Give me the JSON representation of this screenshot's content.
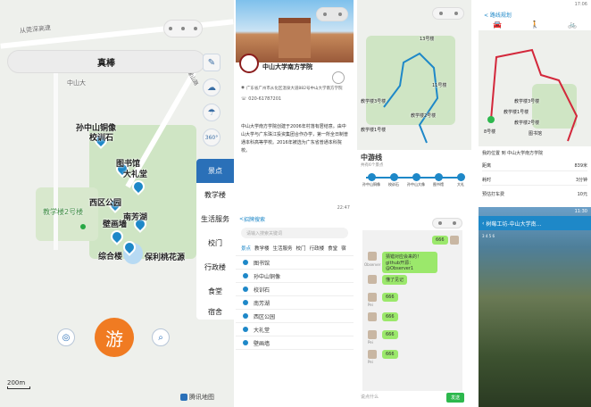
{
  "p1": {
    "search_text": "真棒",
    "map_labels": [
      "孙中山铜像",
      "校训石",
      "图书馆",
      "大礼堂",
      "西区公园",
      "南芳湖",
      "壁画墙",
      "综合楼",
      "保利桃花源",
      "教学楼2号楼",
      "中山大",
      "从莞深高速",
      "田螺山路",
      "教学楼1号楼"
    ],
    "categories": [
      "景点",
      "教学楼",
      "生活服务",
      "校门",
      "行政楼",
      "食堂",
      "宿舍"
    ],
    "scale": "200m",
    "tencent_map": "腾讯地图",
    "fab_label": "游",
    "nav_360": "360°"
  },
  "p2": {
    "status_time": "22:47",
    "school_name": "中山大学南方学院",
    "address": "广东省广州市从化区温泉大道882号中山大学南方学院",
    "phone": "020-61787201",
    "intro": "中山大学南方学院创建于2006年村落有居结意。由中山大学与广东珠江投资集团合作办学，第一所全日制普通本科高等学校。2016年被选为广东省普通本科院校。",
    "status_time_2": "22:47",
    "back": "< ",
    "topbar_title": "招牌搜索",
    "search_ph": "请输入搜索关键词",
    "tabs": [
      "景点",
      "教学楼",
      "生活服务",
      "校门",
      "行政楼",
      "食堂",
      "宿"
    ],
    "list": [
      "图书馆",
      "孙中山铜像",
      "校训石",
      "南芳湖",
      "西区公园",
      "大礼堂",
      "壁画墙"
    ]
  },
  "p3": {
    "route_title": "中游线",
    "route_sub": "共有6个景点",
    "stops": [
      "孙中山铜像",
      "校训石",
      "孙中山大像",
      "图书馆",
      "大礼"
    ],
    "map_labels": [
      "13号楼",
      "教学楼3号楼",
      "11号楼",
      "教学楼2号楼",
      "教学楼1号楼"
    ],
    "chat": [
      "猜错对应会来的！github开源：@Observer1",
      "懂了见记",
      "666",
      "666",
      "666",
      "666",
      "666"
    ],
    "chat_names": [
      "Observer",
      "Pei",
      "Pei",
      "Pei"
    ],
    "input_ph": "说点什么",
    "send": "发送"
  },
  "p4": {
    "status": "17:06",
    "nav_back": "< 路线规划",
    "labels": [
      "教学楼1号楼",
      "教学楼2号楼",
      "教学楼3号楼",
      "图书馆",
      "8号楼"
    ],
    "info_title": "我的位置 到 中山大学南方学院",
    "rows": [
      {
        "k": "距离",
        "v": "839米"
      },
      {
        "k": "耗时",
        "v": "3分钟"
      },
      {
        "k": "预估打车费",
        "v": "10元"
      }
    ],
    "status2": "11:30",
    "live_title": "树莓工坊-中山大学南...",
    "live_stats": "3 4 5 6"
  }
}
